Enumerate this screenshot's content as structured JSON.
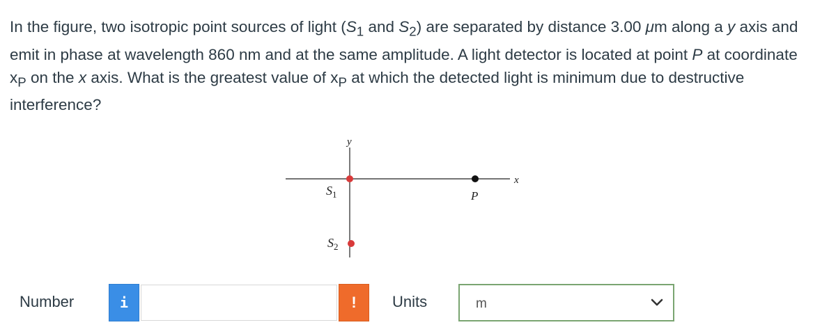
{
  "question": {
    "p1": "In the figure, two isotropic point sources of light (",
    "s1_letter": "S",
    "s1_sub": "1",
    "p2": " and ",
    "s2_letter": "S",
    "s2_sub": "2",
    "p3": ") are separated by distance 3.00 ",
    "mu": "μ",
    "p4": "m along a ",
    "y": "y",
    "p5": " axis and emit in phase at wavelength 860 nm and at the same amplitude. A light detector is located at point ",
    "P": "P",
    "p6": " at coordinate x",
    "sub_p": "P",
    "p7": " on the ",
    "x": "x",
    "p8": " axis. What is the greatest value of x",
    "sub_p2": "P",
    "p9": " at which the detected light is minimum due to destructive interference?"
  },
  "figure": {
    "y_label": "y",
    "x_label": "x",
    "s1_label": "S",
    "s1_sub": "1",
    "s2_label": "S",
    "s2_sub": "2",
    "p_label": "P",
    "source_color": "#d93a3a",
    "detector_color": "#111111"
  },
  "answer": {
    "number_label": "Number",
    "info_icon": "i",
    "number_value": "",
    "warning_icon": "!",
    "units_label": "Units",
    "units_selected": "m"
  },
  "colors": {
    "info": "#3a8ee6",
    "warning": "#ef6b2b",
    "select_border": "#7aa571",
    "text": "#2d3b45"
  }
}
